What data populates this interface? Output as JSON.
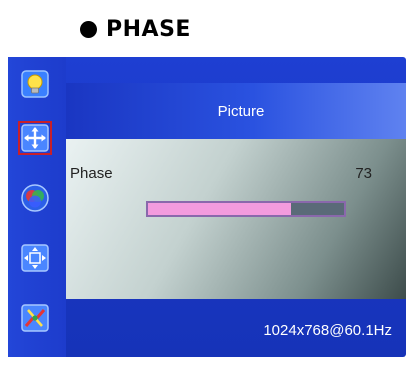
{
  "heading": {
    "title": "PHASE"
  },
  "osd": {
    "sidebar": {
      "items": [
        {
          "name": "brightness",
          "icon": "lightbulb-icon",
          "active": false
        },
        {
          "name": "position",
          "icon": "move-arrows-icon",
          "active": true
        },
        {
          "name": "color",
          "icon": "rgb-circles-icon",
          "active": false
        },
        {
          "name": "size",
          "icon": "expand-arrows-icon",
          "active": false
        },
        {
          "name": "tools",
          "icon": "tools-icon",
          "active": false
        }
      ]
    },
    "title": "Picture",
    "setting": {
      "label": "Phase",
      "value": "73",
      "level": 0.73
    },
    "status": "1024x768@60.1Hz",
    "colors": {
      "highlight": "#c8202a",
      "slider_fill": "#f39bde",
      "slider_border": "#8a68ac"
    }
  }
}
